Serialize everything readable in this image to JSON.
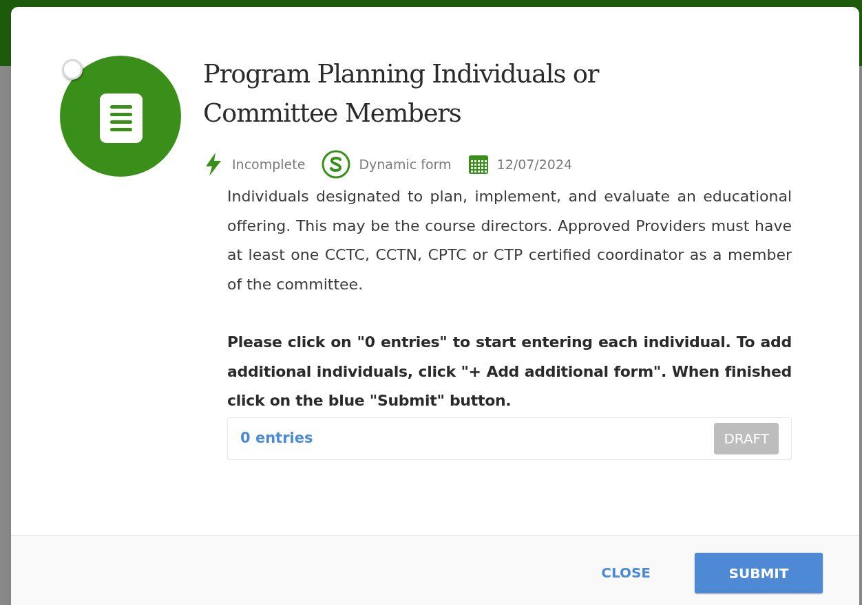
{
  "dialog": {
    "checkbox": {
      "checked": false
    },
    "title": "Program Planning Individuals or Committee Members",
    "meta": [
      {
        "kind": "status",
        "text": "Incomplete"
      },
      {
        "kind": "form_type",
        "text": "Dynamic form"
      },
      {
        "kind": "date",
        "text": "12/07/2024"
      }
    ],
    "description": "Individuals designated to plan, implement, and evaluate an educational offering. This may be the course directors. Approved Providers must have at least one CCTC, CCTN, CPTC or CTP certified coordinator as a member of the committee.",
    "instructions": "Please click on \"0 entries\" to start entering each individual. To add additional individuals, click \"+ Add additional form\". When finished click on the blue \"Submit\" button.",
    "entries": {
      "link": "0 entries",
      "status": "DRAFT"
    },
    "buttons": [
      {
        "kind": "text",
        "label": "CLOSE"
      },
      {
        "kind": "primary",
        "label": "SUBMIT"
      }
    ]
  }
}
